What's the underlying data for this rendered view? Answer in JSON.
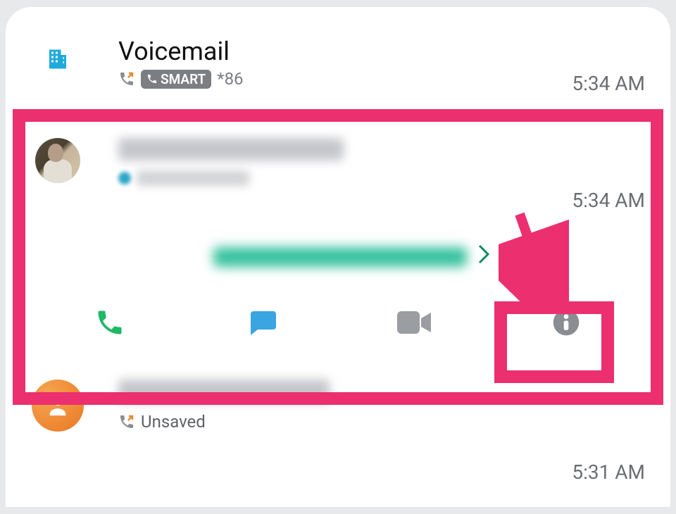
{
  "calls": [
    {
      "title": "Voicemail",
      "badge": "SMART",
      "number": "*86",
      "time": "5:34 AM"
    },
    {
      "title_redacted": true,
      "time": "5:34 AM"
    },
    {
      "title_redacted": true,
      "status": "Unsaved",
      "time": "5:31 AM"
    }
  ],
  "actions": {
    "call": "call-icon",
    "message": "message-icon",
    "video": "video-icon",
    "info": "info-icon"
  },
  "highlight_color": "#eb2f6f"
}
